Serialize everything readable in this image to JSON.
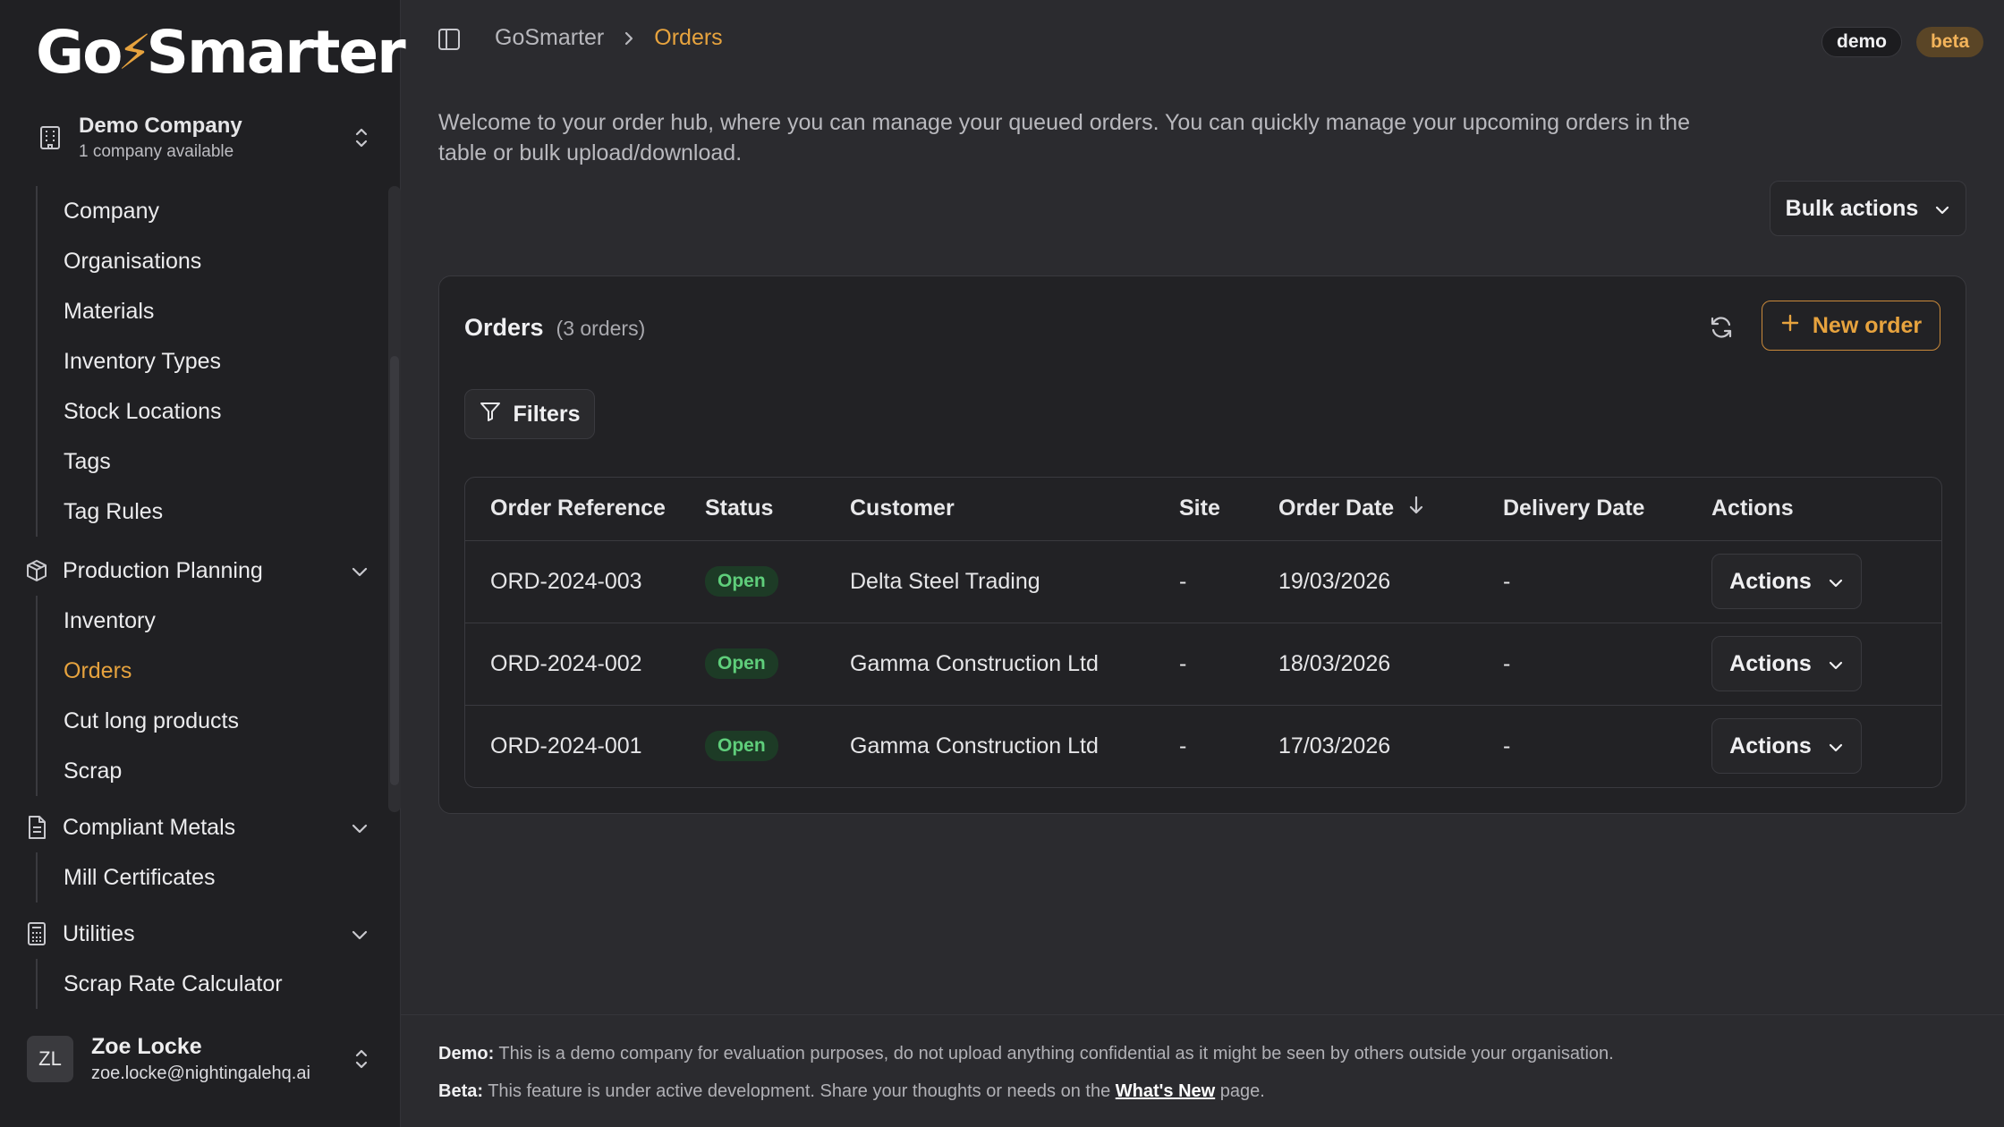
{
  "app": {
    "logo_part1": "Go",
    "logo_part2": "Smarter"
  },
  "company": {
    "name": "Demo Company",
    "subtitle": "1 company available"
  },
  "sidebar": {
    "top_items": [
      {
        "label": "Company"
      },
      {
        "label": "Organisations"
      },
      {
        "label": "Materials"
      },
      {
        "label": "Inventory Types"
      },
      {
        "label": "Stock Locations"
      },
      {
        "label": "Tags"
      },
      {
        "label": "Tag Rules"
      }
    ],
    "groups": [
      {
        "label": "Production Planning",
        "icon": "package-icon",
        "items": [
          {
            "label": "Inventory"
          },
          {
            "label": "Orders"
          },
          {
            "label": "Cut long products"
          },
          {
            "label": "Scrap"
          }
        ]
      },
      {
        "label": "Compliant Metals",
        "icon": "document-icon",
        "items": [
          {
            "label": "Mill Certificates"
          }
        ]
      },
      {
        "label": "Utilities",
        "icon": "calculator-icon",
        "items": [
          {
            "label": "Scrap Rate Calculator"
          }
        ]
      }
    ],
    "active_item": "Orders"
  },
  "user": {
    "initials": "ZL",
    "name": "Zoe Locke",
    "email": "zoe.locke@nightingalehq.ai"
  },
  "breadcrumb": {
    "home": "GoSmarter",
    "current": "Orders"
  },
  "badges": {
    "demo": "demo",
    "beta": "beta"
  },
  "intro": "Welcome to your order hub, where you can manage your queued orders. You can quickly manage your upcoming orders in the table or bulk upload/download.",
  "bulk_actions_label": "Bulk actions",
  "orders": {
    "title": "Orders",
    "count": "(3 orders)",
    "new_order_label": "New order",
    "filters_label": "Filters",
    "columns": [
      "Order Reference",
      "Status",
      "Customer",
      "Site",
      "Order Date",
      "Delivery Date",
      "Actions"
    ],
    "rows": [
      {
        "ref": "ORD-2024-003",
        "status": "Open",
        "customer": "Delta Steel Trading",
        "site": "-",
        "order_date": "19/03/2026",
        "delivery_date": "-",
        "action": "Actions"
      },
      {
        "ref": "ORD-2024-002",
        "status": "Open",
        "customer": "Gamma Construction Ltd",
        "site": "-",
        "order_date": "18/03/2026",
        "delivery_date": "-",
        "action": "Actions"
      },
      {
        "ref": "ORD-2024-001",
        "status": "Open",
        "customer": "Gamma Construction Ltd",
        "site": "-",
        "order_date": "17/03/2026",
        "delivery_date": "-",
        "action": "Actions"
      }
    ]
  },
  "footer": {
    "demo_label": "Demo:",
    "demo_text": " This is a demo company for evaluation purposes, do not upload anything confidential as it might be seen by others outside your organisation.",
    "beta_label": "Beta:",
    "beta_text_before": " This feature is under active development. Share your thoughts or needs on the ",
    "beta_link": "What's New",
    "beta_text_after": " page."
  },
  "colors": {
    "accent": "#e7a33e",
    "status_open": "#5fce7b",
    "background": "#2b2b2f",
    "sidebar": "#202023"
  }
}
